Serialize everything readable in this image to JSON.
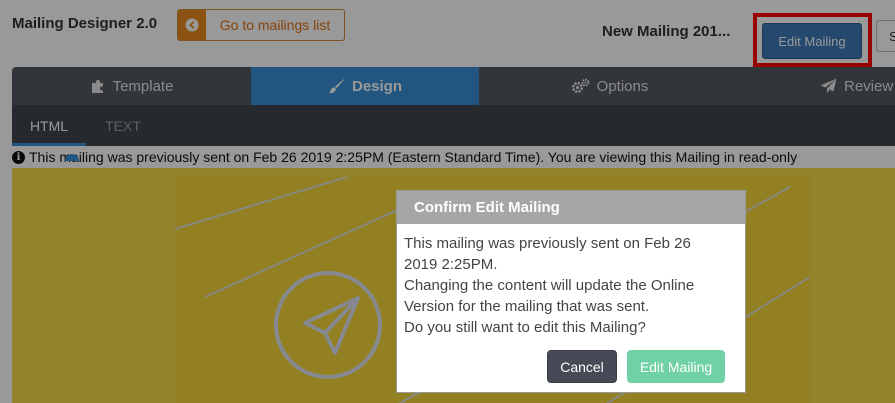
{
  "header": {
    "app_title": "Mailing Designer 2.0",
    "back_button_label": "Go to mailings list",
    "mailing_name": "New Mailing 201...",
    "edit_button_label": "Edit Mailing",
    "save_button_label": "S"
  },
  "tabs": [
    {
      "label": "Template",
      "icon": "puzzle-icon"
    },
    {
      "label": "Design",
      "icon": "brush-icon",
      "active": true
    },
    {
      "label": "Options",
      "icon": "gears-icon"
    },
    {
      "label": "Review & Se",
      "icon": "paper-plane-icon"
    }
  ],
  "subtabs": [
    {
      "label": "HTML",
      "active": true
    },
    {
      "label": "TEXT"
    }
  ],
  "info_message": "This mailing was previously sent on Feb 26 2019 2:25PM (Eastern Standard Time). You are viewing this Mailing in read-only",
  "modal": {
    "title": "Confirm Edit Mailing",
    "lines": [
      "This mailing was previously sent on Feb 26",
      "2019 2:25PM.",
      "Changing the content will update the Online",
      "Version for the mailing that was sent.",
      "Do you still want to edit this Mailing?"
    ],
    "cancel_label": "Cancel",
    "confirm_label": "Edit Mailing"
  },
  "colors": {
    "active_tab": "#3a8fd6",
    "edit_button": "#3c79b8",
    "highlight": "#ff0000",
    "back_button_accent": "#e8891d",
    "confirm_button": "#6fd1a5",
    "cancel_button": "#464a57",
    "canvas_yellow": "#f6dc4a"
  }
}
